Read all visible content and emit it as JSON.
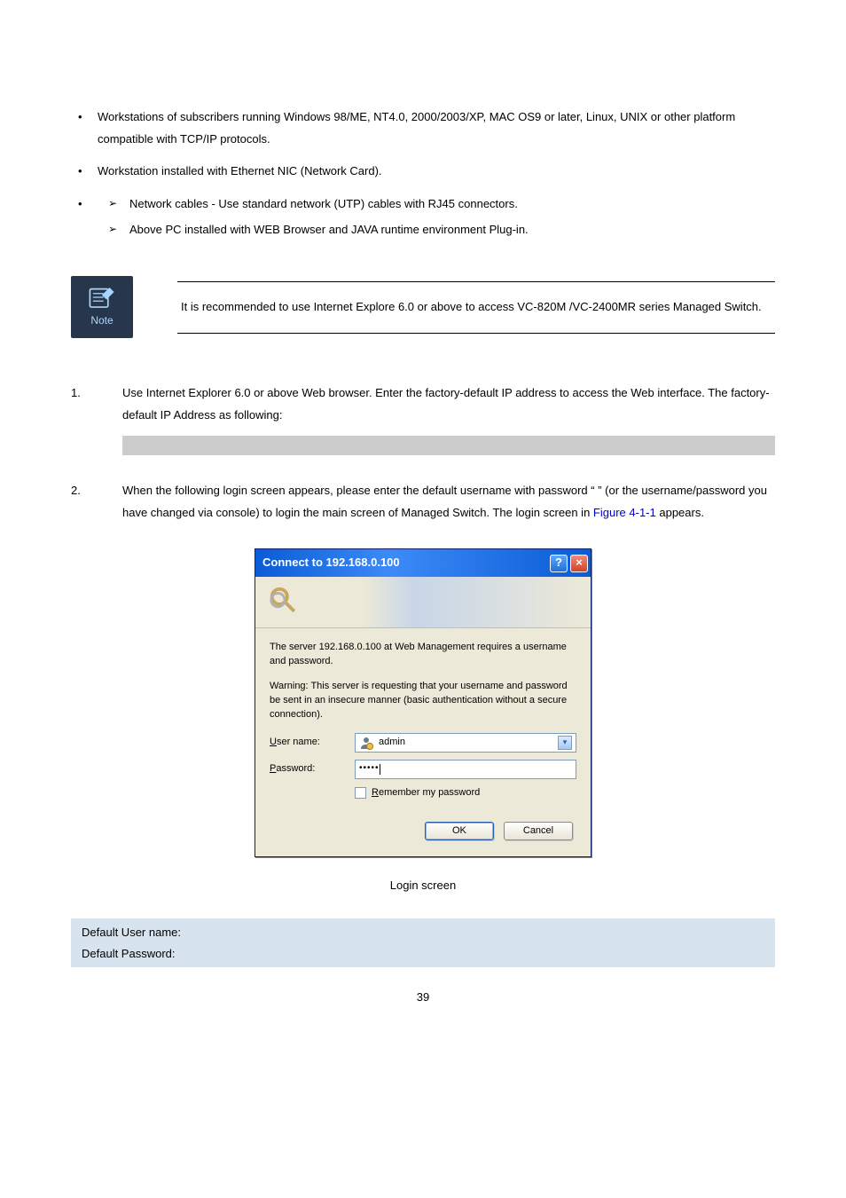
{
  "bullets": {
    "b1": "Workstations of subscribers running Windows 98/ME, NT4.0, 2000/2003/XP, MAC OS9 or later, Linux, UNIX or other platform compatible with TCP/IP protocols.",
    "b2": "Workstation installed with Ethernet NIC (Network Card).",
    "sub1": "Network cables - Use standard network (UTP) cables with RJ45 connectors.",
    "sub2": "Above PC installed with WEB Browser and JAVA runtime environment Plug-in."
  },
  "note": {
    "label": "Note",
    "text": "It is recommended to use Internet Explore 6.0 or above to access VC-820M /VC-2400MR series Managed Switch."
  },
  "steps": {
    "s1_num": "1.",
    "s1_text": "Use Internet Explorer 6.0 or above Web browser. Enter the factory-default IP address to access the Web interface. The factory-default IP Address as following:",
    "s2_num": "2.",
    "s2_pre": "When the following login screen appears, please enter the default username ",
    "s2_mid": " with password “",
    "s2_post": "” (or the username/password you have changed via console) to login the main screen of Managed Switch. The login screen in ",
    "s2_figref": "Figure 4-1-1",
    "s2_tail": " appears."
  },
  "dialog": {
    "title": "Connect to 192.168.0.100",
    "server_msg": "The server 192.168.0.100 at Web Management requires a username and password.",
    "warn_msg": "Warning: This server is requesting that your username and password be sent in an insecure manner (basic authentication without a secure connection).",
    "user_label_pre": "U",
    "user_label_post": "ser name:",
    "user_value": "admin",
    "pass_label_pre": "P",
    "pass_label_post": "assword:",
    "pass_value": "•••••",
    "remember_pre": "R",
    "remember_post": "emember my password",
    "ok": "OK",
    "cancel": "Cancel"
  },
  "caption": "Login screen",
  "defaults": {
    "user_label": "Default User name: ",
    "pass_label": "Default Password: "
  },
  "pagenum": "39"
}
